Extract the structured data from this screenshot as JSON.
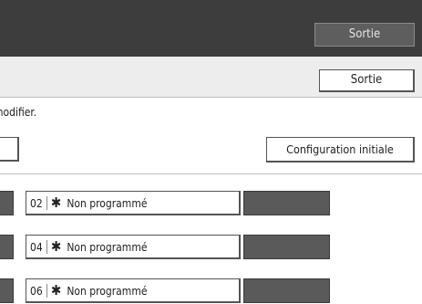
{
  "header": {
    "exit_label": "Sortie"
  },
  "subheader": {
    "exit_label": "Sortie"
  },
  "instruction_text": "modifier.",
  "config_button_label": "Configuration initiale",
  "programs": [
    {
      "number": "02",
      "star": "✱",
      "label": "Non programmé"
    },
    {
      "number": "04",
      "star": "✱",
      "label": "Non programmé"
    },
    {
      "number": "06",
      "star": "✱",
      "label": "Non programmé"
    }
  ]
}
